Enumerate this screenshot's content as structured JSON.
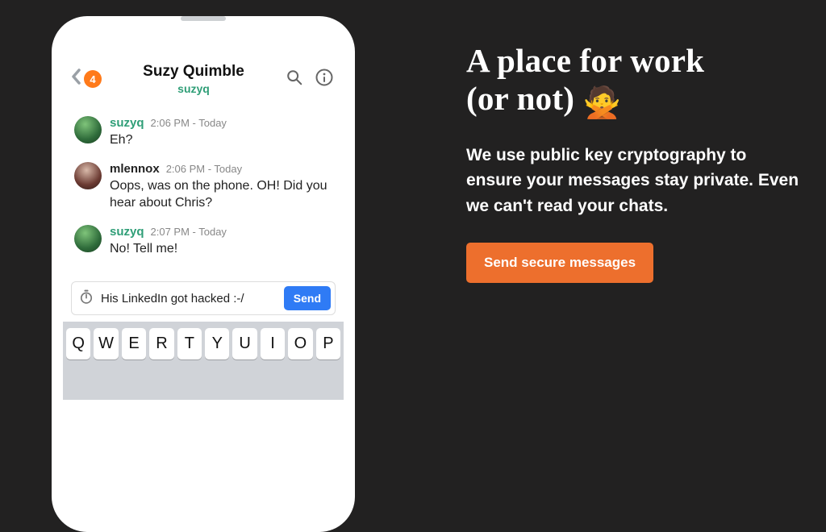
{
  "phone": {
    "back_badge": "4",
    "title": "Suzy Quimble",
    "handle": "suzyq",
    "messages": [
      {
        "user": "suzyq",
        "user_class": "green",
        "time": "2:06 PM - Today",
        "text": "Eh?"
      },
      {
        "user": "mlennox",
        "user_class": "dark",
        "time": "2:06 PM - Today",
        "text": "Oops, was on the phone. OH!  Did you hear about Chris?"
      },
      {
        "user": "suzyq",
        "user_class": "green",
        "time": "2:07 PM - Today",
        "text": "No! Tell me!"
      }
    ],
    "input_value": "His LinkedIn got hacked :-/",
    "send_label": "Send",
    "keys": [
      "Q",
      "W",
      "E",
      "R",
      "T",
      "Y",
      "U",
      "I",
      "O",
      "P"
    ]
  },
  "copy": {
    "headline_l1": "A place for work",
    "headline_l2": "(or not)",
    "emoji": "🙅",
    "sub": "We use public key cryptography to ensure your messages stay private. Even we can't read your chats.",
    "cta": "Send secure messages"
  }
}
